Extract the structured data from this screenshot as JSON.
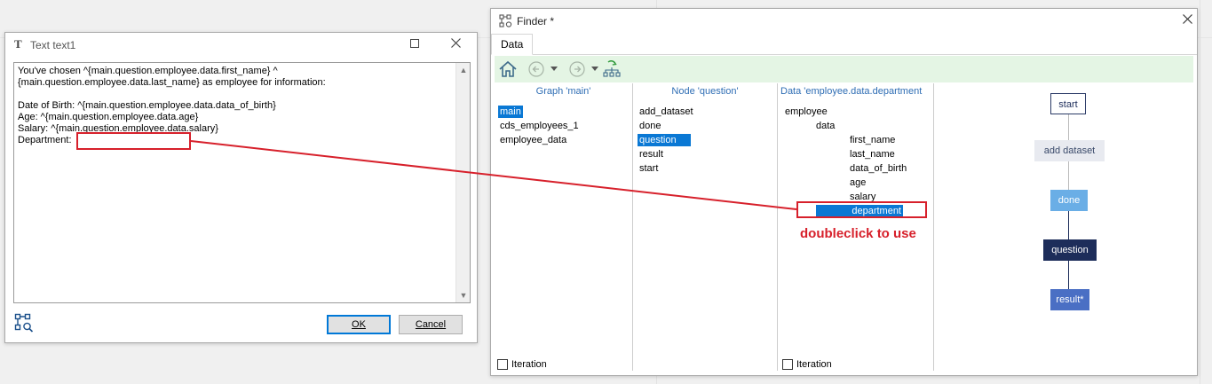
{
  "text_dialog": {
    "title": "Text text1",
    "title_icon": "T",
    "lines": [
      "You've chosen ^{main.question.employee.data.first_name} ^",
      "{main.question.employee.data.last_name} as employee for information:",
      "",
      "Date of Birth: ^{main.question.employee.data.data_of_birth}",
      "Age: ^{main.question.employee.data.age}",
      "Salary: ^{main.question.employee.data.salary}",
      "Department:"
    ],
    "ok_label": "OK",
    "cancel_label": "Cancel"
  },
  "finder": {
    "title": "Finder *",
    "tab": "Data",
    "graph_column": {
      "title": "Graph 'main'",
      "items": [
        "main",
        "cds_employees_1",
        "employee_data"
      ],
      "selected": "main",
      "iteration_label": "Iteration"
    },
    "node_column": {
      "title": "Node 'question'",
      "items": [
        "add_dataset",
        "done",
        "question",
        "result",
        "start"
      ],
      "selected": "question"
    },
    "data_column": {
      "title": "Data 'employee.data.department",
      "root": "employee",
      "child": "data",
      "fields": [
        "first_name",
        "last_name",
        "data_of_birth",
        "age",
        "salary",
        "department"
      ],
      "selected": "department",
      "iteration_label": "Iteration"
    },
    "graph_nodes": [
      {
        "label": "start",
        "style": "outline"
      },
      {
        "label": "add dataset",
        "style": "grey"
      },
      {
        "label": "done",
        "style": "light-blue"
      },
      {
        "label": "question",
        "style": "dark-navy"
      },
      {
        "label": "result*",
        "style": "medium-blue"
      }
    ]
  },
  "annotation": {
    "label": "doubleclick to use",
    "color": "#d7202b"
  },
  "colors": {
    "selection": "#0a78d4",
    "toolbar_bg": "#e4f5e4",
    "column_title": "#2e6db4",
    "node_start_border": "#2a3a66",
    "node_grey": "#e8eaf0",
    "node_light_blue": "#6aaee6",
    "node_dark_navy": "#1d2d5a",
    "node_medium_blue": "#4a6fc4"
  }
}
